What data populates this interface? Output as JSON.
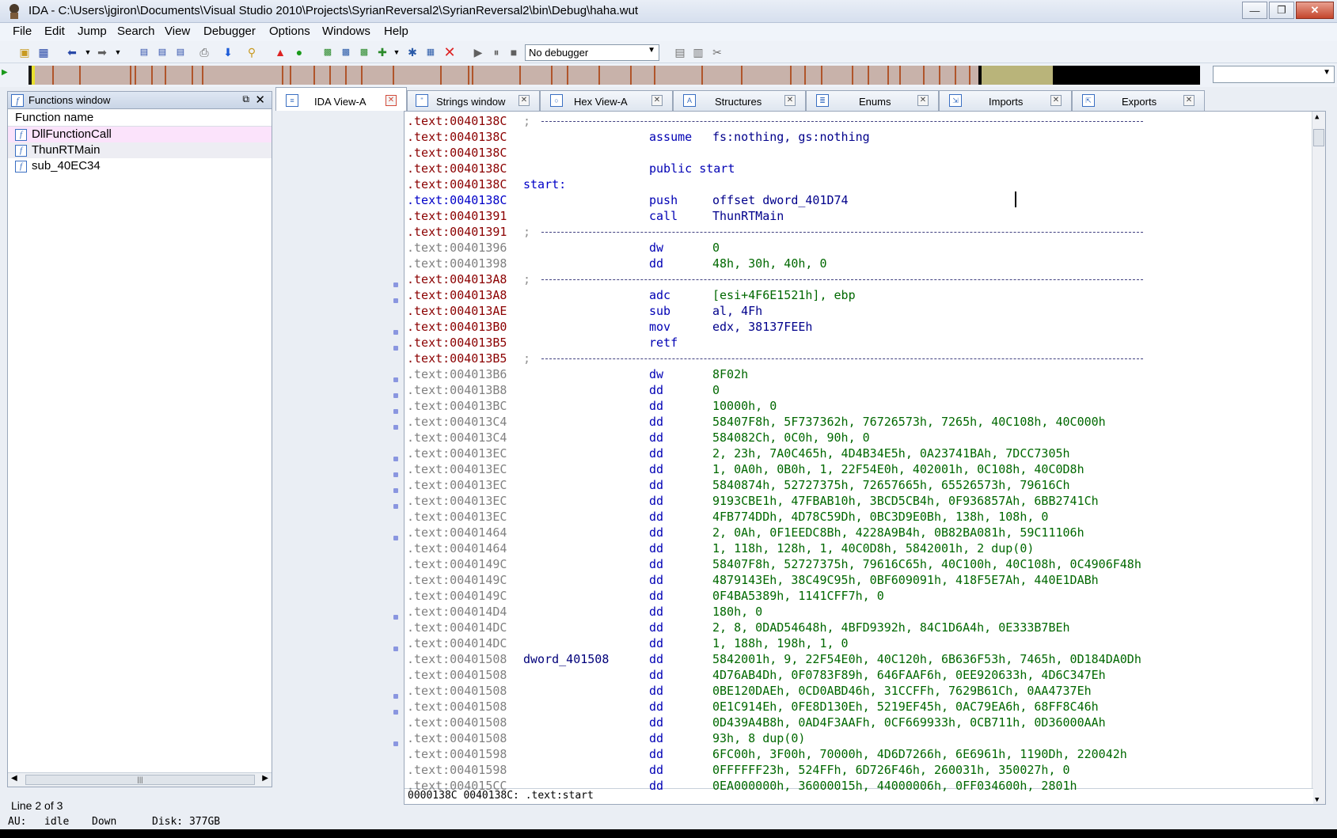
{
  "window": {
    "title": "IDA - C:\\Users\\jgiron\\Documents\\Visual Studio 2010\\Projects\\SyrianReversal2\\SyrianReversal2\\bin\\Debug\\haha.wut",
    "minimize": "—",
    "maximize": "❐",
    "close": "✕"
  },
  "menu": [
    "File",
    "Edit",
    "Jump",
    "Search",
    "View",
    "Debugger",
    "Options",
    "Windows",
    "Help"
  ],
  "toolbar": {
    "debugger_value": "No debugger"
  },
  "functions_window": {
    "title": "Functions window",
    "column_header": "Function name",
    "items": [
      "DllFunctionCall",
      "ThunRTMain",
      "sub_40EC34"
    ],
    "line_status": "Line 2 of 3"
  },
  "tabs": [
    "IDA View-A",
    "Strings window",
    "Hex View-A",
    "Structures",
    "Enums",
    "Imports",
    "Exports"
  ],
  "disasm": {
    "lines": [
      {
        "addr": ".text:0040138C",
        "kind": "sep",
        "tone": "dark"
      },
      {
        "addr": ".text:0040138C",
        "tone": "dark",
        "mnem": "assume",
        "ops": "fs:nothing, gs:nothing",
        "mnem_full": true
      },
      {
        "addr": ".text:0040138C",
        "tone": "dark"
      },
      {
        "addr": ".text:0040138C",
        "tone": "dark",
        "mnem": "public start",
        "mnem_full": true
      },
      {
        "addr": ".text:0040138C",
        "tone": "dark",
        "label": "start:"
      },
      {
        "addr": ".text:0040138C",
        "tone": "blue",
        "dot": true,
        "mnem": "push",
        "ops": "offset dword_401D74"
      },
      {
        "addr": ".text:00401391",
        "tone": "dark",
        "dot": true,
        "mnem": "call",
        "ops": "ThunRTMain"
      },
      {
        "addr": ".text:00401391",
        "kind": "sep",
        "tone": "dark"
      },
      {
        "addr": ".text:00401396",
        "tone": "gray",
        "dot": true,
        "mnem": "dw",
        "ops": "0"
      },
      {
        "addr": ".text:00401398",
        "tone": "gray",
        "dot": true,
        "mnem": "dd",
        "ops": "48h, 30h, 40h, 0"
      },
      {
        "addr": ".text:004013A8",
        "kind": "sep",
        "tone": "dark"
      },
      {
        "addr": ".text:004013A8",
        "tone": "dark",
        "dot": true,
        "mnem": "adc",
        "ops": "[esi+4F6E1521h], ebp"
      },
      {
        "addr": ".text:004013AE",
        "tone": "dark",
        "dot": true,
        "mnem": "sub",
        "ops": "al, 4Fh"
      },
      {
        "addr": ".text:004013B0",
        "tone": "dark",
        "dot": true,
        "mnem": "mov",
        "ops": "edx, 38137FEEh"
      },
      {
        "addr": ".text:004013B5",
        "tone": "dark",
        "dot": true,
        "mnem": "retf",
        "ops": ""
      },
      {
        "addr": ".text:004013B5",
        "kind": "sep",
        "tone": "dark"
      },
      {
        "addr": ".text:004013B6",
        "tone": "gray",
        "dot": true,
        "mnem": "dw",
        "ops": "8F02h"
      },
      {
        "addr": ".text:004013B8",
        "tone": "gray",
        "dot": true,
        "mnem": "dd",
        "ops": "0"
      },
      {
        "addr": ".text:004013BC",
        "tone": "gray",
        "dot": true,
        "mnem": "dd",
        "ops": "10000h, 0"
      },
      {
        "addr": ".text:004013C4",
        "tone": "gray",
        "dot": true,
        "mnem": "dd",
        "ops": "58407F8h, 5F737362h, 76726573h, 7265h, 40C108h, 40C000h"
      },
      {
        "addr": ".text:004013C4",
        "tone": "gray",
        "mnem": "dd",
        "ops": "584082Ch, 0C0h, 90h, 0"
      },
      {
        "addr": ".text:004013EC",
        "tone": "gray",
        "dot": true,
        "mnem": "dd",
        "ops": "2, 23h, 7A0C465h, 4D4B34E5h, 0A23741BAh, 7DCC7305h"
      },
      {
        "addr": ".text:004013EC",
        "tone": "gray",
        "mnem": "dd",
        "ops": "1, 0A0h, 0B0h, 1, 22F54E0h, 402001h, 0C108h, 40C0D8h"
      },
      {
        "addr": ".text:004013EC",
        "tone": "gray",
        "mnem": "dd",
        "ops": "5840874h, 52727375h, 72657665h, 65526573h, 79616Ch"
      },
      {
        "addr": ".text:004013EC",
        "tone": "gray",
        "mnem": "dd",
        "ops": "9193CBE1h, 47FBAB10h, 3BCD5CB4h, 0F936857Ah, 6BB2741Ch"
      },
      {
        "addr": ".text:004013EC",
        "tone": "gray",
        "mnem": "dd",
        "ops": "4FB774DDh, 4D78C59Dh, 0BC3D9E0Bh, 138h, 108h, 0"
      },
      {
        "addr": ".text:00401464",
        "tone": "gray",
        "dot": true,
        "mnem": "dd",
        "ops": "2, 0Ah, 0F1EEDC8Bh, 4228A9B4h, 0B82BA081h, 59C11106h"
      },
      {
        "addr": ".text:00401464",
        "tone": "gray",
        "mnem": "dd",
        "ops": "1, 118h, 128h, 1, 40C0D8h, 5842001h, 2 dup(0)"
      },
      {
        "addr": ".text:0040149C",
        "tone": "gray",
        "dot": true,
        "mnem": "dd",
        "ops": "58407F8h, 52727375h, 79616C65h, 40C100h, 40C108h, 0C4906F48h"
      },
      {
        "addr": ".text:0040149C",
        "tone": "gray",
        "mnem": "dd",
        "ops": "4879143Eh, 38C49C95h, 0BF609091h, 418F5E7Ah, 440E1DABh"
      },
      {
        "addr": ".text:0040149C",
        "tone": "gray",
        "mnem": "dd",
        "ops": "0F4BA5389h, 1141CFF7h, 0"
      },
      {
        "addr": ".text:004014D4",
        "tone": "gray",
        "dot": true,
        "mnem": "dd",
        "ops": "180h, 0"
      },
      {
        "addr": ".text:004014DC",
        "tone": "gray",
        "dot": true,
        "mnem": "dd",
        "ops": "2, 8, 0DAD54648h, 4BFD9392h, 84C1D6A4h, 0E333B7BEh"
      },
      {
        "addr": ".text:004014DC",
        "tone": "gray",
        "mnem": "dd",
        "ops": "1, 188h, 198h, 1, 0"
      },
      {
        "addr": ".text:00401508",
        "tone": "gray",
        "dot": true,
        "label": "dword_401508",
        "mnem": "dd",
        "ops": "5842001h, 9, 22F54E0h, 40C120h, 6B636F53h, 7465h, 0D184DA0Dh"
      },
      {
        "addr": ".text:00401508",
        "tone": "gray",
        "mnem": "dd",
        "ops": "4D76AB4Dh, 0F0783F89h, 646FAAF6h, 0EE920633h, 4D6C347Eh"
      },
      {
        "addr": ".text:00401508",
        "tone": "gray",
        "mnem": "dd",
        "ops": "0BE120DAEh, 0CD0ABD46h, 31CCFFh, 7629B61Ch, 0AA4737Eh"
      },
      {
        "addr": ".text:00401508",
        "tone": "gray",
        "mnem": "dd",
        "ops": "0E1C914Eh, 0FE8D130Eh, 5219EF45h, 0AC79EA6h, 68FF8C46h"
      },
      {
        "addr": ".text:00401508",
        "tone": "gray",
        "mnem": "dd",
        "ops": "0D439A4B8h, 0AD4F3AAFh, 0CF669933h, 0CB711h, 0D36000AAh"
      },
      {
        "addr": ".text:00401508",
        "tone": "gray",
        "mnem": "dd",
        "ops": "93h, 8 dup(0)"
      },
      {
        "addr": ".text:00401598",
        "tone": "gray",
        "dot": true,
        "mnem": "dd",
        "ops": "6FC00h, 3F00h, 70000h, 4D6D7266h, 6E6961h, 1190Dh, 220042h"
      },
      {
        "addr": ".text:00401598",
        "tone": "gray",
        "mnem": "dd",
        "ops": "0FFFFFF23h, 524FFh, 6D726F46h, 260031h, 350027h, 0"
      },
      {
        "addr": ".text:004015CC",
        "tone": "gray",
        "dot": true,
        "mnem": "dd",
        "ops": "0EA000000h, 36000015h, 44000006h, 0FF034600h, 2801h"
      }
    ],
    "status": "0000138C 0040138C: .text:start"
  },
  "statusbar": {
    "au_label": "AU:",
    "au_value": "idle",
    "direction": "Down",
    "disk": "Disk: 377GB"
  },
  "colors": {
    "addr_dark": "#8b0000",
    "addr_gray": "#808080",
    "mnemonic": "#0000b4",
    "operand": "#006800",
    "nav_code": "#b0552b",
    "nav_data": "#b9b47a"
  }
}
